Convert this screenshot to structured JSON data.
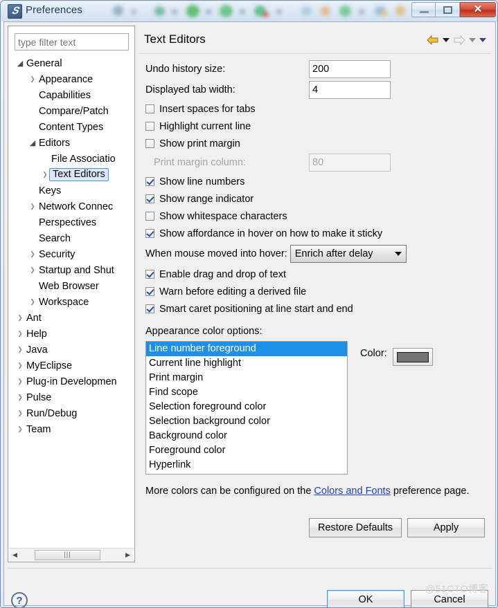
{
  "window": {
    "title": "Preferences",
    "app_icon": "eclipse-icon",
    "buttons": {
      "minimize": "minimize-icon",
      "maximize": "maximize-icon",
      "close": "✕"
    }
  },
  "sidebar": {
    "filter_placeholder": "type filter text",
    "filter_value": "",
    "tree": [
      {
        "label": "General",
        "indent": 0,
        "arrow": "open",
        "selected": false
      },
      {
        "label": "Appearance",
        "indent": 1,
        "arrow": "closed",
        "selected": false
      },
      {
        "label": "Capabilities",
        "indent": 1,
        "arrow": "none",
        "selected": false
      },
      {
        "label": "Compare/Patch",
        "indent": 1,
        "arrow": "none",
        "selected": false
      },
      {
        "label": "Content Types",
        "indent": 1,
        "arrow": "none",
        "selected": false
      },
      {
        "label": "Editors",
        "indent": 1,
        "arrow": "open",
        "selected": false
      },
      {
        "label": "File Associatio",
        "indent": 2,
        "arrow": "none",
        "selected": false
      },
      {
        "label": "Text Editors",
        "indent": 2,
        "arrow": "closed",
        "selected": true
      },
      {
        "label": "Keys",
        "indent": 1,
        "arrow": "none",
        "selected": false
      },
      {
        "label": "Network Connec",
        "indent": 1,
        "arrow": "closed",
        "selected": false
      },
      {
        "label": "Perspectives",
        "indent": 1,
        "arrow": "none",
        "selected": false
      },
      {
        "label": "Search",
        "indent": 1,
        "arrow": "none",
        "selected": false
      },
      {
        "label": "Security",
        "indent": 1,
        "arrow": "closed",
        "selected": false
      },
      {
        "label": "Startup and Shut",
        "indent": 1,
        "arrow": "closed",
        "selected": false
      },
      {
        "label": "Web Browser",
        "indent": 1,
        "arrow": "none",
        "selected": false
      },
      {
        "label": "Workspace",
        "indent": 1,
        "arrow": "closed",
        "selected": false
      },
      {
        "label": "Ant",
        "indent": 0,
        "arrow": "closed",
        "selected": false
      },
      {
        "label": "Help",
        "indent": 0,
        "arrow": "closed",
        "selected": false
      },
      {
        "label": "Java",
        "indent": 0,
        "arrow": "closed",
        "selected": false
      },
      {
        "label": "MyEclipse",
        "indent": 0,
        "arrow": "closed",
        "selected": false
      },
      {
        "label": "Plug-in Developmen",
        "indent": 0,
        "arrow": "closed",
        "selected": false
      },
      {
        "label": "Pulse",
        "indent": 0,
        "arrow": "closed",
        "selected": false
      },
      {
        "label": "Run/Debug",
        "indent": 0,
        "arrow": "closed",
        "selected": false
      },
      {
        "label": "Team",
        "indent": 0,
        "arrow": "closed",
        "selected": false
      }
    ]
  },
  "page": {
    "title": "Text Editors",
    "nav": {
      "back_icon": "back-arrow-icon",
      "back_menu_icon": "chevron-down-icon",
      "forward_icon": "forward-arrow-icon",
      "forward_menu_icon": "chevron-down-icon",
      "extra_menu_icon": "chevron-down-icon"
    },
    "fields": [
      {
        "label": "Undo history size:",
        "value": "200",
        "disabled": false
      },
      {
        "label": "Displayed tab width:",
        "value": "4",
        "disabled": false
      }
    ],
    "checkboxes_top": [
      {
        "label": "Insert spaces for tabs",
        "checked": false
      },
      {
        "label": "Highlight current line",
        "checked": false
      },
      {
        "label": "Show print margin",
        "checked": false
      }
    ],
    "print_margin": {
      "label": "Print margin column:",
      "value": "80",
      "disabled": true
    },
    "checkboxes_mid": [
      {
        "label": "Show line numbers",
        "checked": true
      },
      {
        "label": "Show range indicator",
        "checked": true
      },
      {
        "label": "Show whitespace characters",
        "checked": false
      },
      {
        "label": "Show affordance in hover on how to make it sticky",
        "checked": true
      }
    ],
    "hover": {
      "label": "When mouse moved into hover:",
      "selected": "Enrich after delay"
    },
    "checkboxes_bottom": [
      {
        "label": "Enable drag and drop of text",
        "checked": true
      },
      {
        "label": "Warn before editing a derived file",
        "checked": true
      },
      {
        "label": "Smart caret positioning at line start and end",
        "checked": true
      }
    ],
    "appearance": {
      "label": "Appearance color options:",
      "items": [
        {
          "label": "Line number foreground",
          "selected": true
        },
        {
          "label": "Current line highlight",
          "selected": false
        },
        {
          "label": "Print margin",
          "selected": false
        },
        {
          "label": "Find scope",
          "selected": false
        },
        {
          "label": "Selection foreground color",
          "selected": false
        },
        {
          "label": "Selection background color",
          "selected": false
        },
        {
          "label": "Background color",
          "selected": false
        },
        {
          "label": "Foreground color",
          "selected": false
        },
        {
          "label": "Hyperlink",
          "selected": false
        }
      ],
      "color_label": "Color:",
      "color_value": "#727272"
    },
    "note": {
      "prefix": "More colors can be configured on the ",
      "link": "Colors and Fonts",
      "suffix": " preference page."
    },
    "buttons": {
      "restore_defaults": "Restore Defaults",
      "apply": "Apply"
    }
  },
  "footer": {
    "help_icon": "help-question-icon",
    "ok": "OK",
    "cancel": "Cancel",
    "watermark": "@51CTO博客"
  }
}
